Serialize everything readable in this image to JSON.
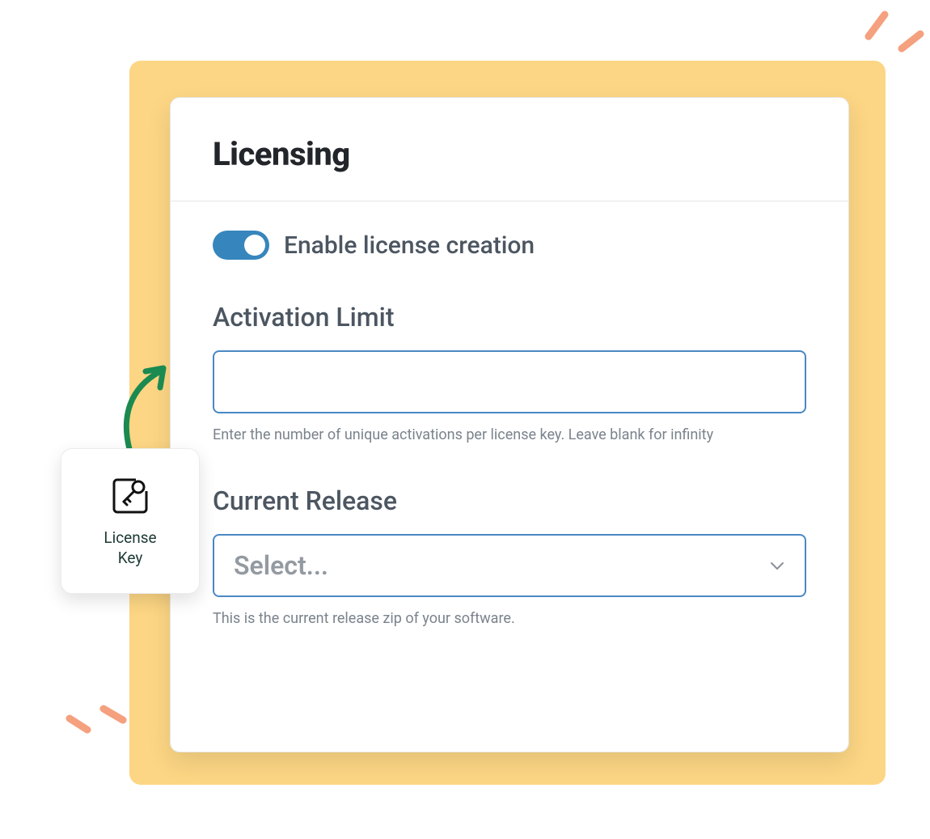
{
  "card": {
    "title": "Licensing",
    "toggle_label": "Enable license creation",
    "toggle_on": true,
    "activation": {
      "label": "Activation Limit",
      "value": "",
      "helper": "Enter the number of unique activations per license key. Leave blank for infinity"
    },
    "release": {
      "label": "Current Release",
      "placeholder": "Select...",
      "helper": "This is the current release zip of your software."
    }
  },
  "badge": {
    "label_line1": "License",
    "label_line2": "Key"
  },
  "colors": {
    "accent_bg": "#fcd684",
    "toggle": "#3686bd",
    "border_blue": "#4a88c4",
    "arrow_green": "#1a8a51",
    "peach": "#f5a07e"
  }
}
